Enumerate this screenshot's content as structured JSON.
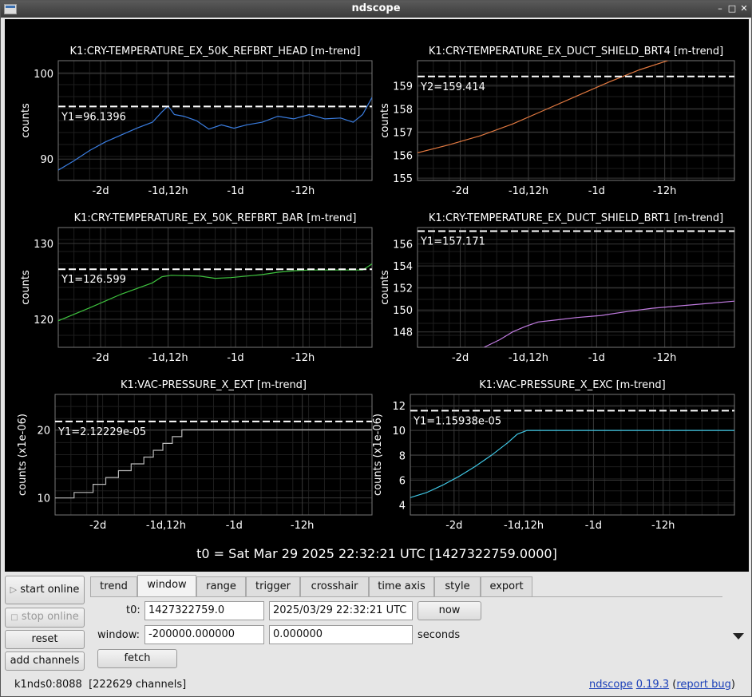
{
  "window": {
    "title": "ndscope"
  },
  "plots": [
    {
      "title": "K1:CRY-TEMPERATURE_EX_50K_REFBRT_HEAD [m-trend]",
      "ylabel": "counts",
      "yticks": [
        "100",
        "90"
      ],
      "xticks": [
        "-2d",
        "-1d,12h",
        "-1d",
        "-12h"
      ],
      "cursor_label": "Y1=96.1396",
      "cursor_value": 96.1396,
      "ylim": [
        87.5,
        101.5
      ],
      "color": "#3a7de0",
      "series": [
        [
          0,
          88.7
        ],
        [
          0.05,
          89.8
        ],
        [
          0.1,
          91
        ],
        [
          0.15,
          92
        ],
        [
          0.2,
          92.8
        ],
        [
          0.25,
          93.6
        ],
        [
          0.3,
          94.3
        ],
        [
          0.33,
          95.5
        ],
        [
          0.35,
          96.2
        ],
        [
          0.37,
          95.2
        ],
        [
          0.4,
          95
        ],
        [
          0.44,
          94.5
        ],
        [
          0.48,
          93.5
        ],
        [
          0.52,
          94
        ],
        [
          0.56,
          93.6
        ],
        [
          0.6,
          94
        ],
        [
          0.65,
          94.3
        ],
        [
          0.7,
          95
        ],
        [
          0.75,
          94.7
        ],
        [
          0.8,
          95.2
        ],
        [
          0.85,
          94.7
        ],
        [
          0.9,
          94.8
        ],
        [
          0.94,
          94.3
        ],
        [
          0.97,
          95.2
        ],
        [
          1.0,
          97.2
        ]
      ]
    },
    {
      "title": "K1:CRY-TEMPERATURE_EX_DUCT_SHIELD_BRT4 [m-trend]",
      "ylabel": "counts",
      "yticks": [
        "159",
        "158",
        "157",
        "156",
        "155"
      ],
      "xticks": [
        "-2d",
        "-1d,12h",
        "-1d",
        "-12h"
      ],
      "cursor_label": "Y2=159.414",
      "cursor_value": 159.414,
      "ylim": [
        154.9,
        160.1
      ],
      "color": "#e07840",
      "series": [
        [
          0,
          156.1
        ],
        [
          0.1,
          156.45
        ],
        [
          0.2,
          156.85
        ],
        [
          0.3,
          157.35
        ],
        [
          0.4,
          157.95
        ],
        [
          0.5,
          158.55
        ],
        [
          0.6,
          159.15
        ],
        [
          0.7,
          159.7
        ],
        [
          0.8,
          160.15
        ]
      ]
    },
    {
      "title": "K1:CRY-TEMPERATURE_EX_50K_REFBRT_BAR [m-trend]",
      "ylabel": "counts",
      "yticks": [
        "130",
        "120"
      ],
      "xticks": [
        "-2d",
        "-1d,12h",
        "-1d",
        "-12h"
      ],
      "cursor_label": "Y1=126.599",
      "cursor_value": 126.599,
      "ylim": [
        116.3,
        132.1
      ],
      "color": "#3ec23e",
      "series": [
        [
          0,
          119.8
        ],
        [
          0.1,
          121.5
        ],
        [
          0.2,
          123.3
        ],
        [
          0.3,
          124.8
        ],
        [
          0.33,
          125.6
        ],
        [
          0.36,
          125.8
        ],
        [
          0.45,
          125.7
        ],
        [
          0.5,
          125.4
        ],
        [
          0.55,
          125.5
        ],
        [
          0.6,
          125.7
        ],
        [
          0.65,
          125.9
        ],
        [
          0.7,
          126.2
        ],
        [
          0.75,
          126.4
        ],
        [
          0.8,
          126.5
        ],
        [
          0.9,
          126.5
        ],
        [
          0.97,
          126.5
        ],
        [
          1.0,
          127.3
        ]
      ]
    },
    {
      "title": "K1:CRY-TEMPERATURE_EX_DUCT_SHIELD_BRT1 [m-trend]",
      "ylabel": "counts",
      "yticks": [
        "156",
        "154",
        "152",
        "150",
        "148"
      ],
      "xticks": [
        "-2d",
        "-1d,12h",
        "-1d",
        "-12h"
      ],
      "cursor_label": "Y1=157.171",
      "cursor_value": 157.171,
      "ylim": [
        146.6,
        157.5
      ],
      "color": "#c07be0",
      "series": [
        [
          0.21,
          146.6
        ],
        [
          0.26,
          147.3
        ],
        [
          0.3,
          148
        ],
        [
          0.34,
          148.5
        ],
        [
          0.38,
          148.9
        ],
        [
          0.44,
          149.1
        ],
        [
          0.5,
          149.3
        ],
        [
          0.58,
          149.5
        ],
        [
          0.66,
          149.85
        ],
        [
          0.74,
          150.15
        ],
        [
          0.82,
          150.35
        ],
        [
          0.9,
          150.55
        ],
        [
          1.0,
          150.8
        ]
      ]
    },
    {
      "title": "K1:VAC-PRESSURE_X_EXT [m-trend]",
      "ylabel": "counts (x1e-06)",
      "yticks": [
        "20",
        "10"
      ],
      "xticks": [
        "-2d",
        "-1d,12h",
        "-1d",
        "-12h"
      ],
      "cursor_label": "Y1=2.12229e-05",
      "cursor_value": 21.2229,
      "ylim": [
        7.5,
        25.2
      ],
      "color": "#b8b8b8",
      "series": [
        [
          0,
          10
        ],
        [
          0.06,
          10
        ],
        [
          0.06,
          10.8
        ],
        [
          0.12,
          10.8
        ],
        [
          0.12,
          12
        ],
        [
          0.16,
          12
        ],
        [
          0.16,
          13
        ],
        [
          0.2,
          13
        ],
        [
          0.2,
          14
        ],
        [
          0.24,
          14
        ],
        [
          0.24,
          15
        ],
        [
          0.28,
          15
        ],
        [
          0.28,
          16
        ],
        [
          0.31,
          16
        ],
        [
          0.31,
          17
        ],
        [
          0.34,
          17
        ],
        [
          0.34,
          18
        ],
        [
          0.37,
          18
        ],
        [
          0.37,
          19
        ],
        [
          0.4,
          19
        ],
        [
          0.4,
          20
        ],
        [
          1.0,
          20
        ]
      ]
    },
    {
      "title": "K1:VAC-PRESSURE_X_EXC [m-trend]",
      "ylabel": "counts (x1e-06)",
      "yticks": [
        "12",
        "10",
        "8",
        "6",
        "4"
      ],
      "xticks": [
        "-2d",
        "-1d,12h",
        "-1d",
        "-12h"
      ],
      "cursor_label": "Y1=1.15938e-05",
      "cursor_value": 11.5938,
      "ylim": [
        3.2,
        12.9
      ],
      "color": "#40c8e6",
      "series": [
        [
          0,
          4.6
        ],
        [
          0.05,
          5
        ],
        [
          0.1,
          5.6
        ],
        [
          0.15,
          6.3
        ],
        [
          0.2,
          7.1
        ],
        [
          0.25,
          8
        ],
        [
          0.3,
          9
        ],
        [
          0.33,
          9.7
        ],
        [
          0.36,
          10
        ],
        [
          1.0,
          10
        ]
      ]
    }
  ],
  "t0_label": "t0 = Sat Mar 29 2025 22:32:21 UTC [1427322759.0000]",
  "controls": {
    "start_online": "start online",
    "stop_online": "stop online",
    "reset": "reset",
    "add_channels": "add channels",
    "tabs": [
      "trend",
      "window",
      "range",
      "trigger",
      "crosshair",
      "time axis",
      "style",
      "export"
    ],
    "active_tab": "window",
    "t0_label": "t0:",
    "t0_gps": "1427322759.0",
    "t0_utc": "2025/03/29 22:32:21 UTC",
    "now": "now",
    "window_label": "window:",
    "window_start": "-200000.000000",
    "window_end": "0.000000",
    "seconds": "seconds",
    "fetch": "fetch"
  },
  "status": {
    "server": "k1nds0:8088",
    "channels": "[222629 channels]"
  },
  "footer": {
    "app": "ndscope",
    "version": "0.19.3",
    "bug_paren_open": "(",
    "bug": "report bug",
    "bug_paren_close": ")"
  }
}
